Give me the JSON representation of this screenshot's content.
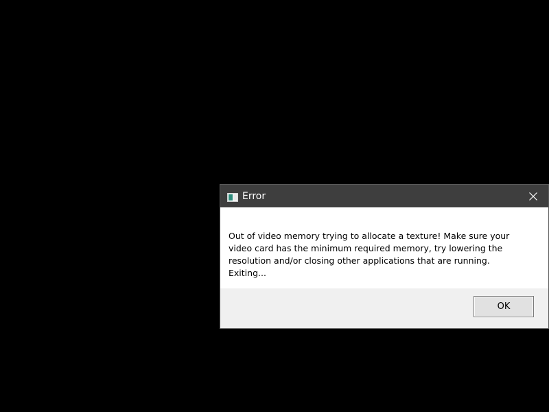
{
  "dialog": {
    "title": "Error",
    "icon": "app-window-icon",
    "close_icon": "close-icon",
    "message": "Out of video memory trying to allocate a texture! Make sure your video card has the minimum required memory, try lowering the resolution and/or closing other applications that are running. Exiting...",
    "ok_label": "OK"
  },
  "colors": {
    "background": "#000000",
    "titlebar": "#3e3e3e",
    "content": "#ffffff",
    "footer": "#f0f0f0"
  }
}
